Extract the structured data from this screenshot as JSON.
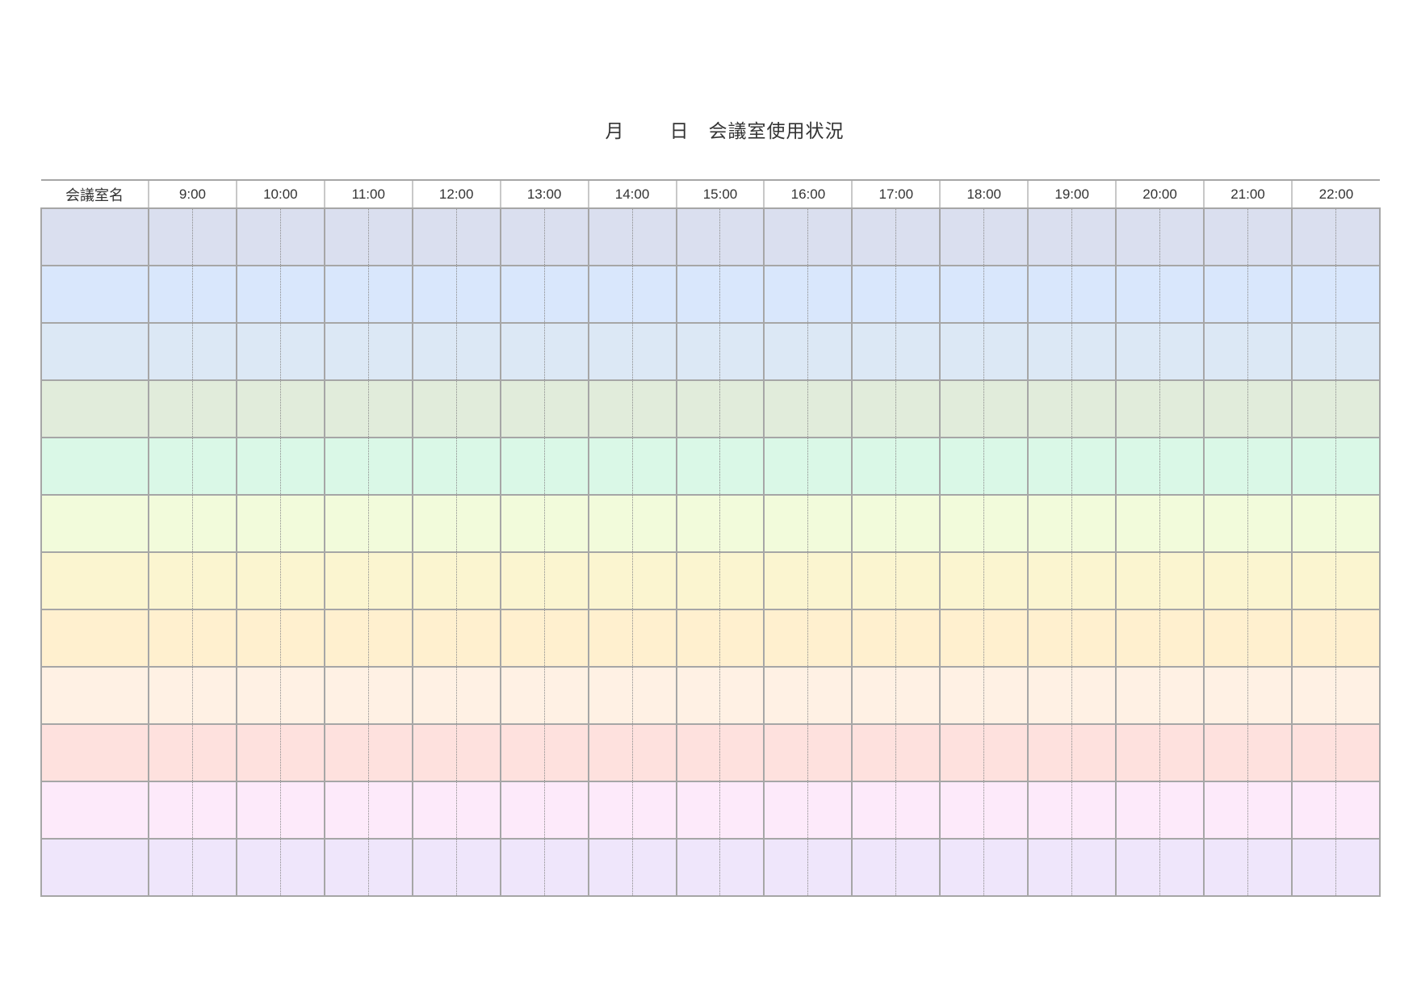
{
  "title": {
    "month": "月",
    "day": "日",
    "name": "会議室使用状況"
  },
  "table": {
    "room_header": "会議室名",
    "hours": [
      "9:00",
      "10:00",
      "11:00",
      "12:00",
      "13:00",
      "14:00",
      "15:00",
      "16:00",
      "17:00",
      "18:00",
      "19:00",
      "20:00",
      "21:00",
      "22:00"
    ],
    "row_colors": [
      "#dadfef",
      "#d9e7fc",
      "#dce8f5",
      "#e1ecdb",
      "#daf8e7",
      "#f2fbdb",
      "#fbf5d0",
      "#fff0cf",
      "#fff1e4",
      "#fee1de",
      "#fdeafa",
      "#efe6fb"
    ]
  }
}
